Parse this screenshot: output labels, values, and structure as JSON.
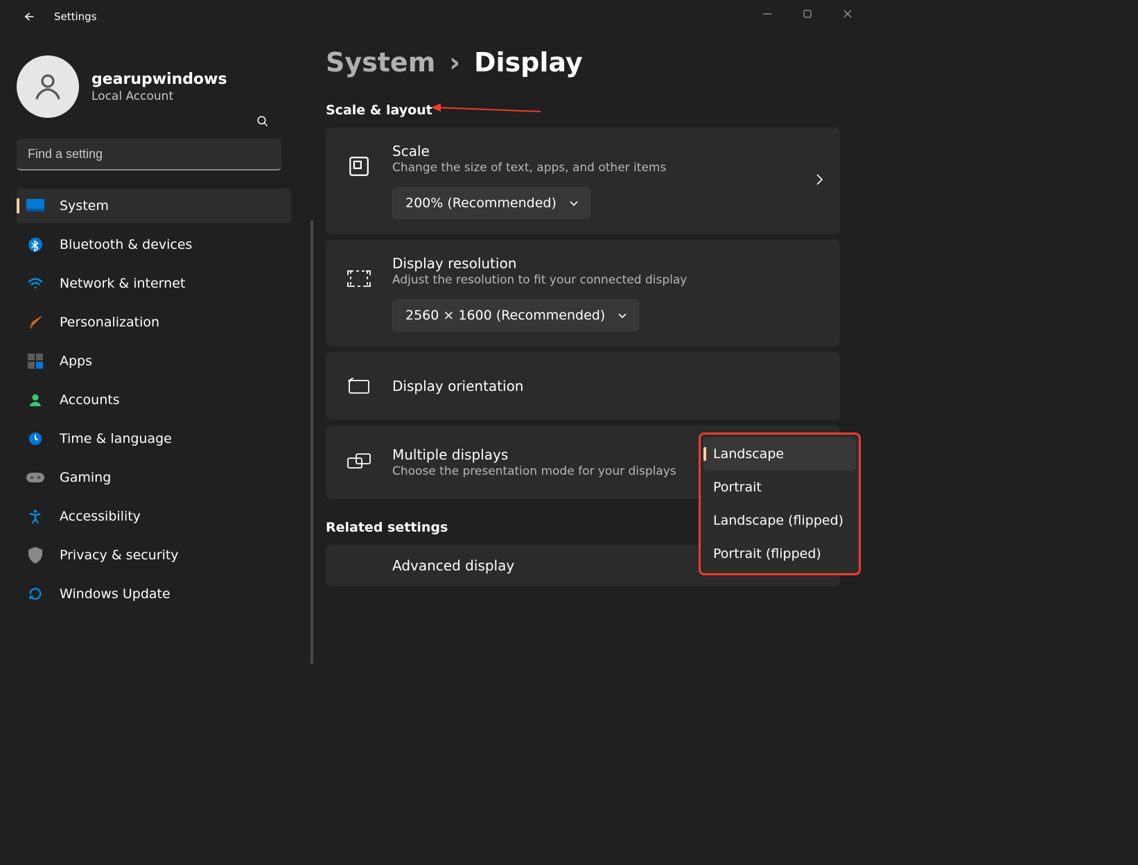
{
  "window": {
    "title": "Settings"
  },
  "account": {
    "name": "gearupwindows",
    "type": "Local Account"
  },
  "search": {
    "placeholder": "Find a setting"
  },
  "nav": {
    "items": [
      {
        "label": "System"
      },
      {
        "label": "Bluetooth & devices"
      },
      {
        "label": "Network & internet"
      },
      {
        "label": "Personalization"
      },
      {
        "label": "Apps"
      },
      {
        "label": "Accounts"
      },
      {
        "label": "Time & language"
      },
      {
        "label": "Gaming"
      },
      {
        "label": "Accessibility"
      },
      {
        "label": "Privacy & security"
      },
      {
        "label": "Windows Update"
      }
    ]
  },
  "breadcrumb": {
    "parent": "System",
    "sep": "›",
    "current": "Display"
  },
  "sections": {
    "scale_layout": {
      "title": "Scale & layout",
      "scale": {
        "title": "Scale",
        "sub": "Change the size of text, apps, and other items",
        "value": "200% (Recommended)"
      },
      "resolution": {
        "title": "Display resolution",
        "sub": "Adjust the resolution to fit your connected display",
        "value": "2560 × 1600 (Recommended)"
      },
      "orientation": {
        "title": "Display orientation",
        "options": [
          "Landscape",
          "Portrait",
          "Landscape (flipped)",
          "Portrait (flipped)"
        ]
      },
      "multiple": {
        "title": "Multiple displays",
        "sub": "Choose the presentation mode for your displays"
      }
    },
    "related": {
      "title": "Related settings",
      "advanced": {
        "title": "Advanced display"
      }
    }
  }
}
